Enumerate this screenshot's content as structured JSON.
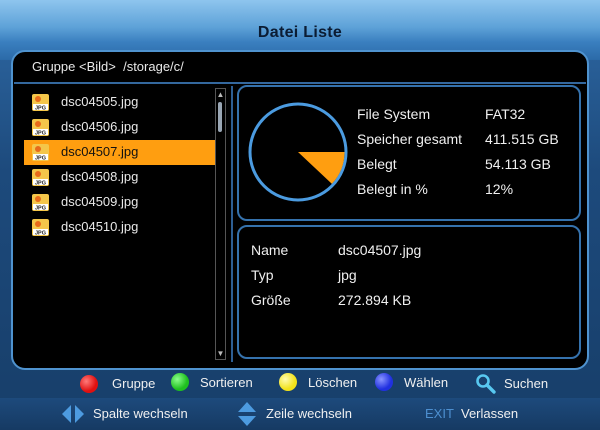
{
  "window": {
    "title": "Datei Liste"
  },
  "path": {
    "group_label": "Gruppe <Bild>",
    "path_value": "/storage/c/"
  },
  "files": [
    {
      "name": "dsc04505.jpg",
      "icon": "jpg-file-icon"
    },
    {
      "name": "dsc04506.jpg",
      "icon": "jpg-file-icon"
    },
    {
      "name": "dsc04507.jpg",
      "icon": "jpg-file-icon"
    },
    {
      "name": "dsc04508.jpg",
      "icon": "jpg-file-icon"
    },
    {
      "name": "dsc04509.jpg",
      "icon": "jpg-file-icon"
    },
    {
      "name": "dsc04510.jpg",
      "icon": "jpg-file-icon"
    }
  ],
  "selected_index": 2,
  "storage": {
    "fs_label": "File System",
    "fs_value": "FAT32",
    "total_label": "Speicher gesamt",
    "total_value": "411.515 GB",
    "used_label": "Belegt",
    "used_value": "54.113 GB",
    "pct_label": "Belegt in %",
    "pct_value": "12%",
    "used_fraction": 0.12,
    "pie_used_color": "#ff9e10",
    "pie_ring_color": "#4b9be0"
  },
  "details": {
    "name_label": "Name",
    "name_value": "dsc04507.jpg",
    "type_label": "Typ",
    "type_value": "jpg",
    "size_label": "Größe",
    "size_value": "272.894 KB"
  },
  "legend": {
    "red": {
      "label": "Gruppe",
      "color": "#e01010"
    },
    "green": {
      "label": "Sortieren",
      "color": "#1fc01f"
    },
    "yellow": {
      "label": "Löschen",
      "color": "#f2e21a"
    },
    "blue": {
      "label": "Wählen",
      "color": "#2030e0"
    },
    "search": {
      "label": "Suchen",
      "icon": "wrench-search-icon"
    }
  },
  "footer": {
    "column_label": "Spalte wechseln",
    "column_icon": "left-right-arrows-icon",
    "row_label": "Zeile wechseln",
    "row_icon": "up-down-arrows-icon",
    "exit_key": "EXIT",
    "exit_label": "Verlassen"
  }
}
